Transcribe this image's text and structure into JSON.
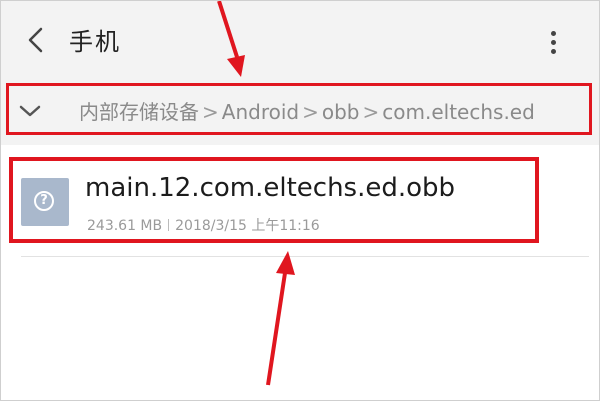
{
  "header": {
    "title": "手机",
    "back_icon": "back-chevron-icon",
    "menu_icon": "more-vertical-icon"
  },
  "breadcrumb": {
    "toggle_icon": "chevron-down-icon",
    "items": [
      "内部存储设备",
      "Android",
      "obb",
      "com.eltechs.ed"
    ],
    "separator": ">"
  },
  "file": {
    "icon": "unknown-file-icon",
    "name": "main.12.com.eltechs.ed.obb",
    "size": "243.61 MB",
    "date": "2018/3/15 上午11:16"
  },
  "colors": {
    "annotation_red": "#e0161f",
    "bar_background": "#f3f3f3",
    "file_icon_bg": "#a9b8cc"
  }
}
